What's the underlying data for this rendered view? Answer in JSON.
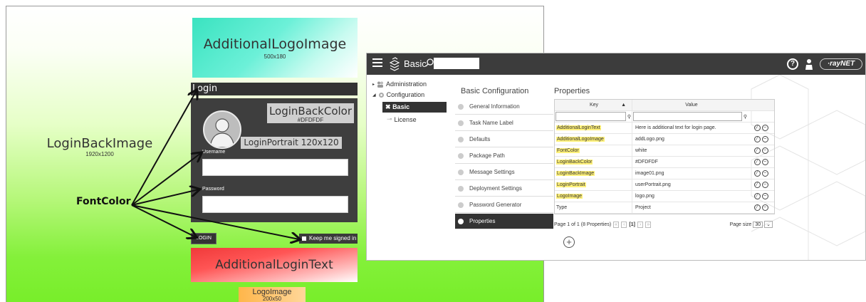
{
  "login_mock": {
    "additional_logo": {
      "title": "AdditionalLogoImage",
      "size": "500x180"
    },
    "login_title": "Login",
    "back_color": {
      "title": "LoginBackColor",
      "value": "#DFDFDF"
    },
    "portrait": {
      "title": "LoginPortrait 120x120"
    },
    "username_label": "Username",
    "password_label": "Password",
    "login_button": "LOGIN",
    "keep_signed": "Keep me signed in",
    "additional_text": "AdditionalLoginText",
    "logo_image": {
      "title": "LogoImage",
      "size": "200x50"
    },
    "back_image": {
      "title": "LoginBackImage",
      "size": "1920x1200"
    },
    "font_color": "FontColor"
  },
  "app": {
    "title": "Basic",
    "header_icons": [
      "hamburger-icon",
      "boxes-icon",
      "search-icon",
      "help-icon",
      "user-icon"
    ],
    "logo": "·rayNET",
    "tree": {
      "administration": "Administration",
      "configuration": "Configuration",
      "basic": "Basic",
      "license": "License"
    },
    "basic_config_title": "Basic Configuration",
    "menu": [
      "General Information",
      "Task Name Label",
      "Defaults",
      "Package Path",
      "Message Settings",
      "Deployment Settings",
      "Password Generator",
      "Properties"
    ],
    "active_menu_index": 7,
    "properties_title": "Properties",
    "table": {
      "headers": {
        "key": "Key",
        "value": "Value"
      },
      "rows": [
        {
          "key": "AdditionalLoginText",
          "value": "Here is additional text for login page.",
          "highlight": true
        },
        {
          "key": "AdditionalLogoImage",
          "value": "addLogo.png",
          "highlight": true
        },
        {
          "key": "FontColor",
          "value": "white",
          "highlight": true
        },
        {
          "key": "LoginBackColor",
          "value": "#DFDFDF",
          "highlight": true
        },
        {
          "key": "LoginBackImage",
          "value": "image01.png",
          "highlight": true
        },
        {
          "key": "LoginPortrait",
          "value": "userPortrait.png",
          "highlight": true
        },
        {
          "key": "LogoImage",
          "value": "logo.png",
          "highlight": true
        },
        {
          "key": "Type",
          "value": "Project",
          "highlight": false
        }
      ]
    },
    "pager": {
      "summary": "Page 1 of 1 (8 Properties)",
      "current": "[1]",
      "page_size_label": "Page size",
      "page_size": "30"
    },
    "colors": {
      "header": "#3c3c3c",
      "highlight": "#fff17a",
      "active": "#333333"
    }
  }
}
